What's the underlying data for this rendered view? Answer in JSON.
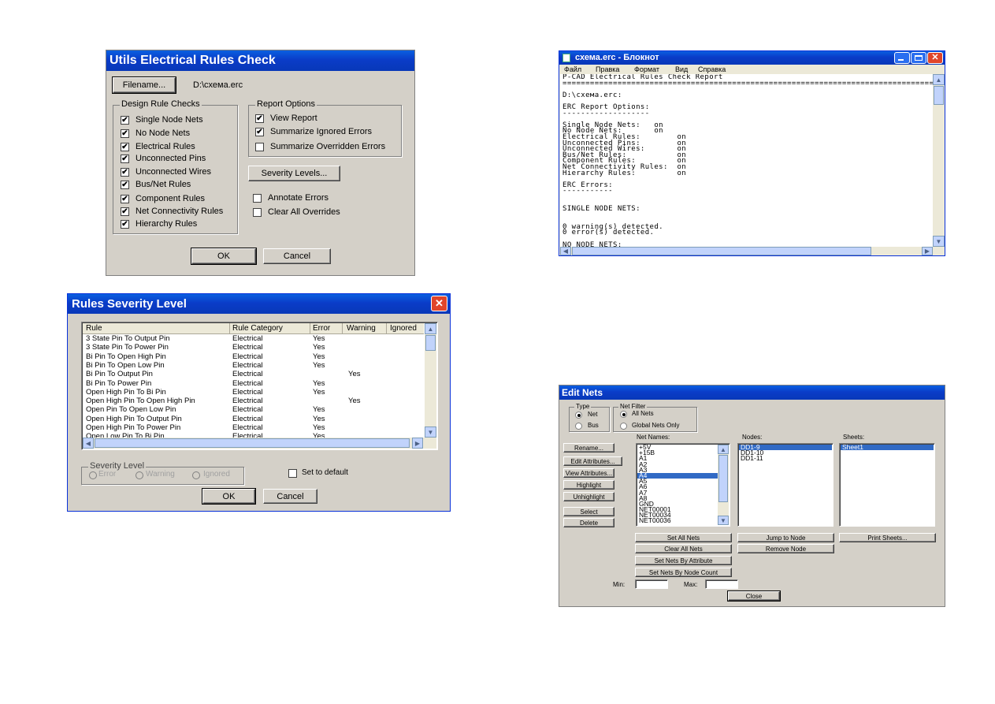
{
  "erc_dialog": {
    "title": "Utils Electrical Rules Check",
    "filename_button": "Filename...",
    "filename_value": "D:\\схема.erc",
    "design_rule_checks": {
      "title": "Design Rule Checks",
      "items": [
        {
          "label": "Single Node Nets",
          "checked": "✔"
        },
        {
          "label": "No Node Nets",
          "checked": "✔"
        },
        {
          "label": "Electrical Rules",
          "checked": "✔"
        },
        {
          "label": "Unconnected Pins",
          "checked": "✔"
        },
        {
          "label": "Unconnected Wires",
          "checked": "✔"
        },
        {
          "label": "Bus/Net Rules",
          "checked": "✔"
        },
        {
          "label": "Component Rules",
          "checked": "✔"
        },
        {
          "label": "Net Connectivity Rules",
          "checked": "✔"
        },
        {
          "label": "Hierarchy Rules",
          "checked": "✔"
        }
      ]
    },
    "report_options": {
      "title": "Report Options",
      "view_report": "View Report",
      "view_report_mark": "✔",
      "summarize_ignored": "Summarize Ignored Errors",
      "summarize_ignored_mark": "✔",
      "summarize_overridden": "Summarize Overridden Errors"
    },
    "severity_button": "Severity Levels...",
    "annotate_errors": "Annotate Errors",
    "clear_overrides": "Clear All Overrides",
    "ok": "OK",
    "cancel": "Cancel"
  },
  "notepad": {
    "title": "схема.erc - Блокнот",
    "menu": [
      "Файл",
      "Правка",
      "Формат",
      "Вид",
      "Справка"
    ],
    "lines": [
      "P-CAD Electrical Rules Check Report",
      "=================================================================================",
      "",
      "D:\\схема.erc:",
      "",
      "ERC Report Options:",
      "-------------------",
      "",
      "Single Node Nets:   on",
      "No Node Nets:       on",
      "Electrical Rules:        on",
      "Unconnected Pins:        on",
      "Unconnected Wires:       on",
      "Bus/Net Rules:           on",
      "Component Rules:         on",
      "Net Connectivity Rules:  on",
      "Hierarchy Rules:         on",
      "",
      "ERC Errors:",
      "-----------",
      "",
      "",
      "SINGLE NODE NETS:",
      "",
      "",
      "0 warning(s) detected.",
      "0 error(s) detected.",
      "",
      "NO NODE NETS:"
    ],
    "colors": {
      "titlebar": "#0a3cc8",
      "close": "#e0452a"
    }
  },
  "severity": {
    "title": "Rules Severity Level",
    "columns": [
      "Rule",
      "Rule Category",
      "Error",
      "Warning",
      "Ignored"
    ],
    "rows": [
      {
        "rule": "3 State Pin To Output Pin",
        "cat": "Electrical",
        "error": "Yes",
        "warning": ""
      },
      {
        "rule": "3 State Pin To Power Pin",
        "cat": "Electrical",
        "error": "Yes",
        "warning": ""
      },
      {
        "rule": "Bi Pin To Open High Pin",
        "cat": "Electrical",
        "error": "Yes",
        "warning": ""
      },
      {
        "rule": "Bi Pin To Open Low Pin",
        "cat": "Electrical",
        "error": "Yes",
        "warning": ""
      },
      {
        "rule": "Bi Pin To Output Pin",
        "cat": "Electrical",
        "error": "",
        "warning": "Yes"
      },
      {
        "rule": "Bi Pin To Power Pin",
        "cat": "Electrical",
        "error": "Yes",
        "warning": ""
      },
      {
        "rule": "Open High Pin To Bi Pin",
        "cat": "Electrical",
        "error": "Yes",
        "warning": ""
      },
      {
        "rule": "Open High Pin To Open High Pin",
        "cat": "Electrical",
        "error": "",
        "warning": "Yes"
      },
      {
        "rule": "Open Pin To Open Low Pin",
        "cat": "Electrical",
        "error": "Yes",
        "warning": ""
      },
      {
        "rule": "Open High Pin To Output Pin",
        "cat": "Electrical",
        "error": "Yes",
        "warning": ""
      },
      {
        "rule": "Open High Pin To Power Pin",
        "cat": "Electrical",
        "error": "Yes",
        "warning": ""
      },
      {
        "rule": "Open Low Pin To Bi Pin",
        "cat": "Electrical",
        "error": "Yes",
        "warning": ""
      }
    ],
    "severity_level": {
      "title": "Severity Level",
      "error": "Error",
      "warning": "Warning",
      "ignored": "Ignored"
    },
    "set_default": "Set to default",
    "ok": "OK",
    "cancel": "Cancel"
  },
  "edit_nets": {
    "title": "Edit Nets",
    "type": {
      "title": "Type",
      "net": "Net",
      "bus": "Bus"
    },
    "net_filter": {
      "title": "Net Filter",
      "all": "All Nets",
      "global": "Global Nets Only"
    },
    "net_names_label": "Net Names:",
    "nodes_label": "Nodes:",
    "sheets_label": "Sheets:",
    "net_names": [
      "+5V",
      "+15B",
      "A1",
      "A2",
      "A3",
      "A4",
      "A5",
      "A6",
      "A7",
      "A8",
      "GND",
      "NET00001",
      "NET00034",
      "NET00036"
    ],
    "selected_net": "A4",
    "nodes": [
      "DD1-9",
      "DD1-10",
      "DD1-11"
    ],
    "sheets": [
      "Sheet1"
    ],
    "left_buttons": [
      "Rename...",
      "Edit Attributes...",
      "View Attributes...",
      "Highlight",
      "Unhighlight",
      "Select",
      "Delete"
    ],
    "set_all_nets": "Set All Nets",
    "clear_all_nets": "Clear All Nets",
    "set_by_attr": "Set Nets By Attribute",
    "set_by_count": "Set Nets By Node Count",
    "jump_to_node": "Jump to Node",
    "remove_node": "Remove Node",
    "print_sheets": "Print Sheets...",
    "min_label": "Min:",
    "max_label": "Max:",
    "close": "Close"
  }
}
